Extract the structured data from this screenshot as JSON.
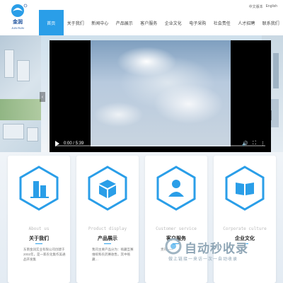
{
  "logo": {
    "name": "金润",
    "sub": "JUN RUN"
  },
  "topbar": {
    "chinese": "中文版本",
    "english": "English"
  },
  "nav": {
    "items": [
      {
        "label": "首页"
      },
      {
        "label": "关于我们"
      },
      {
        "label": "新闻中心"
      },
      {
        "label": "产品展示"
      },
      {
        "label": "客户服务"
      },
      {
        "label": "企业文化"
      },
      {
        "label": "电子采购"
      },
      {
        "label": "社会责任"
      },
      {
        "label": "人才招聘"
      },
      {
        "label": "联系我们"
      }
    ]
  },
  "video": {
    "time": "0:00 / 5:39",
    "progress": 0
  },
  "hero": {
    "prev": "‹",
    "next": "›"
  },
  "cards": [
    {
      "en": "About us",
      "cn": "关于我们",
      "desc": "东南金润实业有限公司创建于2002年，是一家农化集作美通品开发集",
      "icon": "building-icon"
    },
    {
      "en": "Product display",
      "cn": "产品展示",
      "desc": "我司主要产品分为：殖藏互赛维缤和农药赛收售，其中殖藏…",
      "icon": "box-icon"
    },
    {
      "en": "Customer service",
      "cn": "客户服务",
      "desc": "贵司——",
      "icon": "person-icon"
    },
    {
      "en": "Corporate culture",
      "cn": "企业文化",
      "desc": "",
      "icon": "book-icon"
    }
  ],
  "watermark": {
    "title": "自动秒收录",
    "sub": "做上链接一来访一次一自动收录"
  },
  "colors": {
    "accent": "#2a9ee8",
    "hex": "#2a9ee8"
  }
}
